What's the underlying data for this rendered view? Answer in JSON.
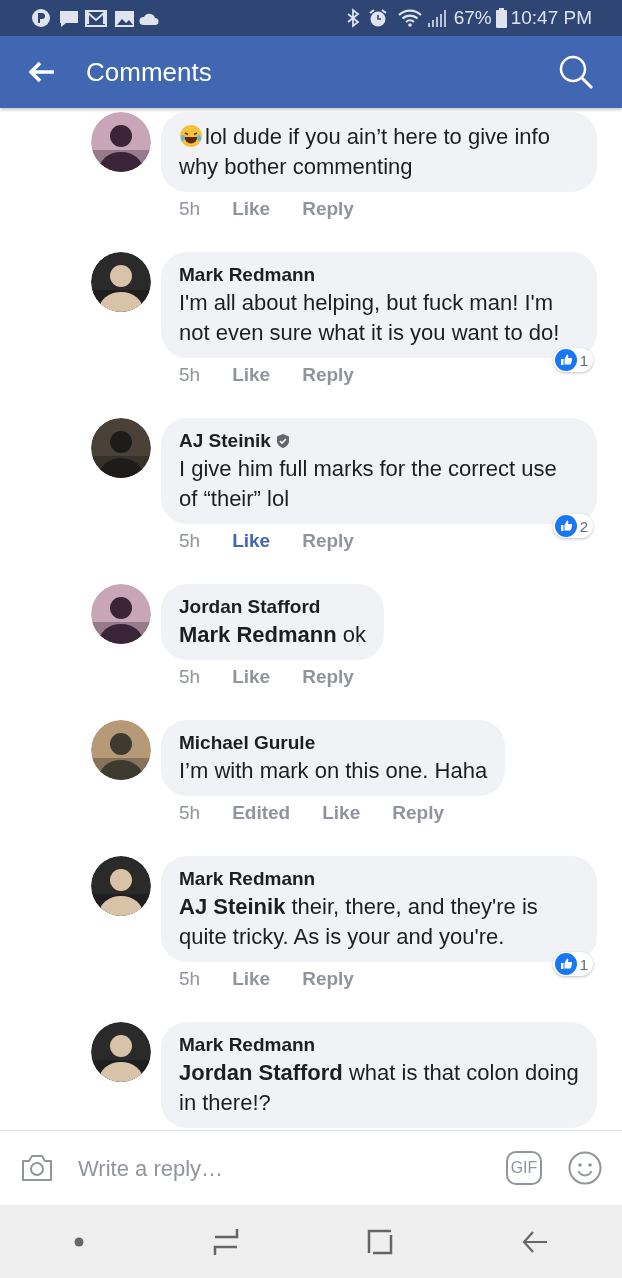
{
  "status_bar": {
    "battery": "67%",
    "time": "10:47 PM"
  },
  "header": {
    "title": "Comments"
  },
  "comments": [
    {
      "kind": "emoji_text",
      "text": "lol dude if you ain’t here to give info why bother commenting",
      "time": "5h",
      "like": {
        "label": "Like",
        "selected": false
      },
      "reply": "Reply"
    },
    {
      "name": "Mark Redmann",
      "text": "I'm all about helping, but fuck man! I'm not even sure what it is you want to do!",
      "time": "5h",
      "like": {
        "label": "Like",
        "selected": false
      },
      "reply": "Reply",
      "reactions": "1"
    },
    {
      "name": "AJ Steinik",
      "verified": true,
      "text": "I give him full marks for the correct use of “their” lol",
      "time": "5h",
      "like": {
        "label": "Like",
        "selected": true
      },
      "reply": "Reply",
      "reactions": "2"
    },
    {
      "name": "Jordan Stafford",
      "text": "**Mark Redmann** ok",
      "time": "5h",
      "like": {
        "label": "Like",
        "selected": false
      },
      "reply": "Reply"
    },
    {
      "name": "Michael Gurule",
      "text": "I’m with mark on this one. Haha",
      "time": "5h",
      "edited": "Edited",
      "like": {
        "label": "Like",
        "selected": false
      },
      "reply": "Reply"
    },
    {
      "name": "Mark Redmann",
      "text": "**AJ Steinik** their, there, and they're is quite tricky. As is your and you're.",
      "time": "5h",
      "like": {
        "label": "Like",
        "selected": false
      },
      "reply": "Reply",
      "reactions": "1"
    },
    {
      "name": "Mark Redmann",
      "text": "**Jordan Stafford** what is that colon doing in there!?"
    }
  ],
  "composer": {
    "placeholder": "Write a reply…",
    "gif": "GIF"
  }
}
